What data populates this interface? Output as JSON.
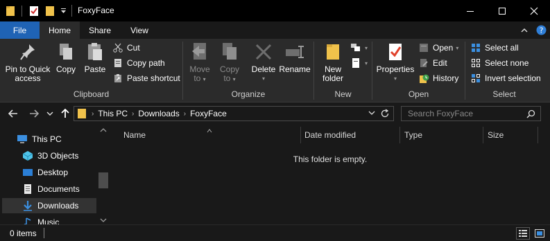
{
  "window": {
    "title": "FoxyFace",
    "minimize_icon": "minimize-icon",
    "maximize_icon": "maximize-icon",
    "close_icon": "close-icon"
  },
  "ribbon_tabs": [
    {
      "label": "File"
    },
    {
      "label": "Home"
    },
    {
      "label": "Share"
    },
    {
      "label": "View"
    }
  ],
  "clipboard": {
    "label": "Clipboard",
    "pin_label_1": "Pin to Quick",
    "pin_label_2": "access",
    "copy_label": "Copy",
    "paste_label": "Paste",
    "cut_label": "Cut",
    "copy_path_label": "Copy path",
    "paste_shortcut_label": "Paste shortcut"
  },
  "organize": {
    "label": "Organize",
    "move_to_1": "Move",
    "move_to_2": "to",
    "copy_to_1": "Copy",
    "copy_to_2": "to",
    "delete_label": "Delete",
    "rename_label": "Rename"
  },
  "new_group": {
    "label": "New",
    "new_folder_1": "New",
    "new_folder_2": "folder"
  },
  "open_group": {
    "label": "Open",
    "properties_label": "Properties",
    "open_label": "Open",
    "edit_label": "Edit",
    "history_label": "History"
  },
  "select_group": {
    "label": "Select",
    "select_all": "Select all",
    "select_none": "Select none",
    "invert_selection": "Invert selection"
  },
  "address": {
    "crumbs": [
      "This PC",
      "Downloads",
      "FoxyFace"
    ],
    "search_placeholder": "Search FoxyFace"
  },
  "nav_pane": {
    "items": [
      {
        "label": "This PC",
        "icon": "computer-icon"
      },
      {
        "label": "3D Objects",
        "icon": "cube-icon"
      },
      {
        "label": "Desktop",
        "icon": "desktop-icon"
      },
      {
        "label": "Documents",
        "icon": "document-icon"
      },
      {
        "label": "Downloads",
        "icon": "download-icon",
        "selected": true
      },
      {
        "label": "Music",
        "icon": "music-icon"
      }
    ]
  },
  "columns": [
    {
      "label": "Name"
    },
    {
      "label": "Date modified"
    },
    {
      "label": "Type"
    },
    {
      "label": "Size"
    }
  ],
  "empty_message": "This folder is empty.",
  "status": {
    "item_count": "0 items"
  },
  "colors": {
    "accent": "#1f63b5",
    "folder": "#f0c24b",
    "background": "#191919",
    "ribbon": "#2b2b2b"
  }
}
